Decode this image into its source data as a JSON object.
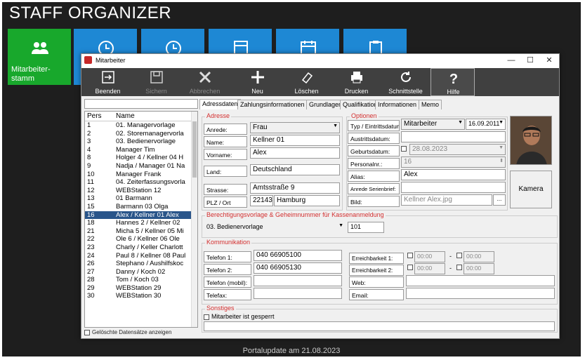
{
  "app": {
    "title": "STAFF ORGANIZER",
    "footer": "Portalupdate am 21.08.2023"
  },
  "tiles": [
    {
      "label": "Mitarbeiter-\nstamm",
      "color": "#18a82c"
    },
    {
      "label": "",
      "color": "#1e88d4"
    }
  ],
  "window": {
    "title": "Mitarbeiter",
    "min": "—",
    "max": "☐",
    "close": "✕"
  },
  "toolbar": {
    "beenden": "Beenden",
    "sichern": "Sichern",
    "abbrechen": "Abbrechen",
    "neu": "Neu",
    "loeschen": "Löschen",
    "drucken": "Drucken",
    "schnittstelle": "Schnittstelle",
    "hilfe": "Hilfe"
  },
  "list": {
    "col_pers": "Pers",
    "col_name": "Name",
    "rows": [
      {
        "pers": "1",
        "name": "01. Managervorlage"
      },
      {
        "pers": "2",
        "name": "02. Storemanagervorla"
      },
      {
        "pers": "3",
        "name": "03. Bedienervorlage"
      },
      {
        "pers": "4",
        "name": "Manager Tim"
      },
      {
        "pers": "8",
        "name": "Holger 4 / Kellner 04 H"
      },
      {
        "pers": "9",
        "name": "Nadja / Manager 01 Na"
      },
      {
        "pers": "10",
        "name": "Manager Frank"
      },
      {
        "pers": "11",
        "name": "04. Zeiterfassungsvorla"
      },
      {
        "pers": "12",
        "name": "WEBStation 12"
      },
      {
        "pers": "13",
        "name": "01 Barmann"
      },
      {
        "pers": "15",
        "name": "Barmann 03 Olga"
      },
      {
        "pers": "16",
        "name": "Alex / Kellner 01 Alex"
      },
      {
        "pers": "18",
        "name": "Hannes 2 / Kellner 02"
      },
      {
        "pers": "21",
        "name": "Micha 5 / Kellner 05 Mi"
      },
      {
        "pers": "22",
        "name": "Ole 6 / Kellner 06 Ole"
      },
      {
        "pers": "23",
        "name": "Charly / Keller Charlott"
      },
      {
        "pers": "24",
        "name": "Paul 8 / Kellner 08 Paul"
      },
      {
        "pers": "26",
        "name": "Stephano / Aushilfskoc"
      },
      {
        "pers": "27",
        "name": "Danny /  Koch 02"
      },
      {
        "pers": "28",
        "name": "Tom /  Koch 03"
      },
      {
        "pers": "29",
        "name": "WEBStation 29"
      },
      {
        "pers": "30",
        "name": "WEBStation 30"
      }
    ],
    "selected_index": 11,
    "deleted_label": "Gelöschte Datensätze anzeigen"
  },
  "tabs": [
    "Adressdaten",
    "Zahlungsinformationen",
    "Grundlagen",
    "Qualifikation",
    "Informationen",
    "Memo"
  ],
  "adresse": {
    "title": "Adresse",
    "anrede_l": "Anrede:",
    "anrede": "Frau",
    "name_l": "Name:",
    "name": "Kellner 01",
    "vorname_l": "Vorname:",
    "vorname": "Alex",
    "land_l": "Land:",
    "land": "Deutschland",
    "strasse_l": "Strasse:",
    "strasse": "Amtsstraße 9",
    "plz_l": "PLZ / Ort",
    "plz": "22143",
    "ort": "Hamburg"
  },
  "optionen": {
    "title": "Optionen",
    "typ_l": "Typ / Eintrittsdatum:",
    "typ": "Mitarbeiter",
    "eintritt": "16.09.2011",
    "austritt_l": "Austrittsdatum:",
    "geburt_l": "Geburtsdatum:",
    "geburt": "28.08.2023",
    "personal_l": "Personalnr.:",
    "personal": "16",
    "alias_l": "Alias:",
    "alias": "Alex",
    "anrede_l": "Anrede Serienbrief:",
    "bild_l": "Bild:",
    "bild": "Kellner Alex.jpg",
    "bild_btn": "..."
  },
  "kamera": "Kamera",
  "berechtigung": {
    "title": "Berechtigungsvorlage & Geheimnummer für Kassenanmeldung",
    "vorlage": "03. Bedienervorlage",
    "nummer": "101"
  },
  "kommunikation": {
    "title": "Kommunikation",
    "tel1_l": "Telefon 1:",
    "tel1": "040 66905100",
    "tel2_l": "Telefon 2:",
    "tel2": "040 66905130",
    "mobil_l": "Telefon (mobil):",
    "fax_l": "Telefax:",
    "erreich1_l": "Erreichbarkeit 1:",
    "erreich2_l": "Erreichbarkeit 2:",
    "time": "00:00",
    "dash": "-",
    "web_l": "Web:",
    "email_l": "Email:"
  },
  "sonstiges": {
    "title": "Sonstiges",
    "gesperrt": "Mitarbeiter ist gesperrt"
  }
}
